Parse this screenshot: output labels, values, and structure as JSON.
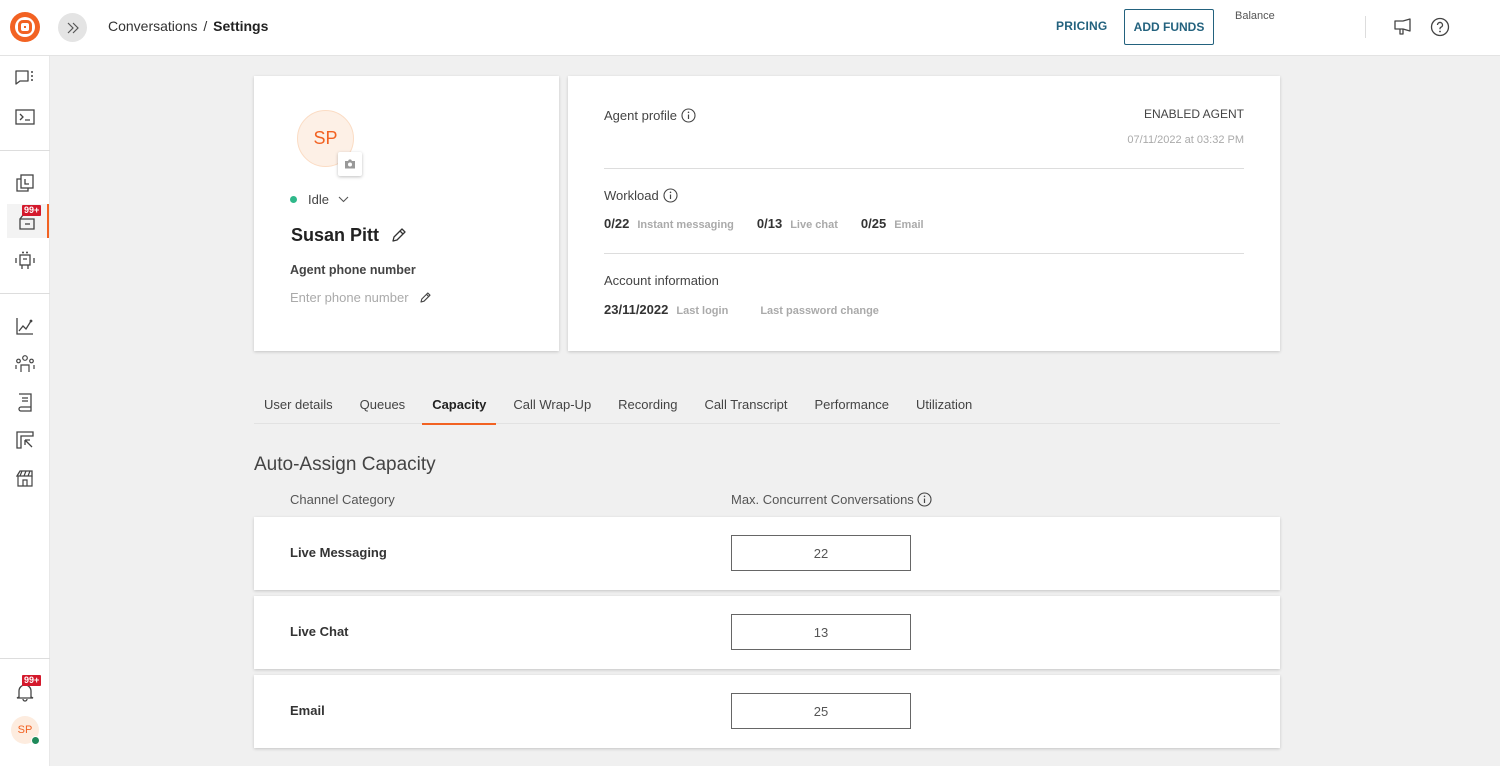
{
  "header": {
    "breadcrumb_parent": "Conversations",
    "breadcrumb_separator": "/",
    "breadcrumb_current": "Settings",
    "pricing_label": "PRICING",
    "add_funds_label": "ADD FUNDS",
    "balance_label": "Balance"
  },
  "sidebar": {
    "items": [
      {
        "name": "conversations",
        "icon": "chat-icon"
      },
      {
        "name": "console",
        "icon": "terminal-icon"
      },
      {
        "name": "templates",
        "icon": "copy-icon"
      },
      {
        "name": "inbox",
        "icon": "inbox-icon",
        "badge": "99+",
        "active": true
      },
      {
        "name": "bots",
        "icon": "robot-icon"
      },
      {
        "name": "analytics",
        "icon": "chart-icon"
      },
      {
        "name": "people",
        "icon": "people-icon"
      },
      {
        "name": "knowledge",
        "icon": "book-icon"
      },
      {
        "name": "campaigns",
        "icon": "cursor-icon"
      },
      {
        "name": "store",
        "icon": "store-icon"
      }
    ],
    "notification_badge": "99+",
    "user_initials": "SP"
  },
  "profile": {
    "initials": "SP",
    "status": "Idle",
    "name": "Susan Pitt",
    "phone_label": "Agent phone number",
    "phone_placeholder": "Enter phone number"
  },
  "info": {
    "agent_profile_label": "Agent profile",
    "agent_state": "ENABLED AGENT",
    "agent_state_date": "07/11/2022 at 03:32 PM",
    "workload_label": "Workload",
    "workload": [
      {
        "value": "0/22",
        "label": "Instant messaging"
      },
      {
        "value": "0/13",
        "label": "Live chat"
      },
      {
        "value": "0/25",
        "label": "Email"
      }
    ],
    "account_label": "Account information",
    "last_login_value": "23/11/2022",
    "last_login_label": "Last login",
    "last_password_value": "",
    "last_password_label": "Last password change"
  },
  "tabs": [
    {
      "label": "User details"
    },
    {
      "label": "Queues"
    },
    {
      "label": "Capacity",
      "active": true
    },
    {
      "label": "Call Wrap-Up"
    },
    {
      "label": "Recording"
    },
    {
      "label": "Call Transcript"
    },
    {
      "label": "Performance"
    },
    {
      "label": "Utilization"
    }
  ],
  "capacity": {
    "title": "Auto-Assign Capacity",
    "col_category": "Channel Category",
    "col_max": "Max. Concurrent Conversations",
    "rows": [
      {
        "category": "Live Messaging",
        "value": "22"
      },
      {
        "category": "Live Chat",
        "value": "13"
      },
      {
        "category": "Email",
        "value": "25"
      }
    ]
  },
  "colors": {
    "brand": "#f26222",
    "link": "#23627e",
    "badge": "#d4192c",
    "online": "#2fb88a"
  }
}
